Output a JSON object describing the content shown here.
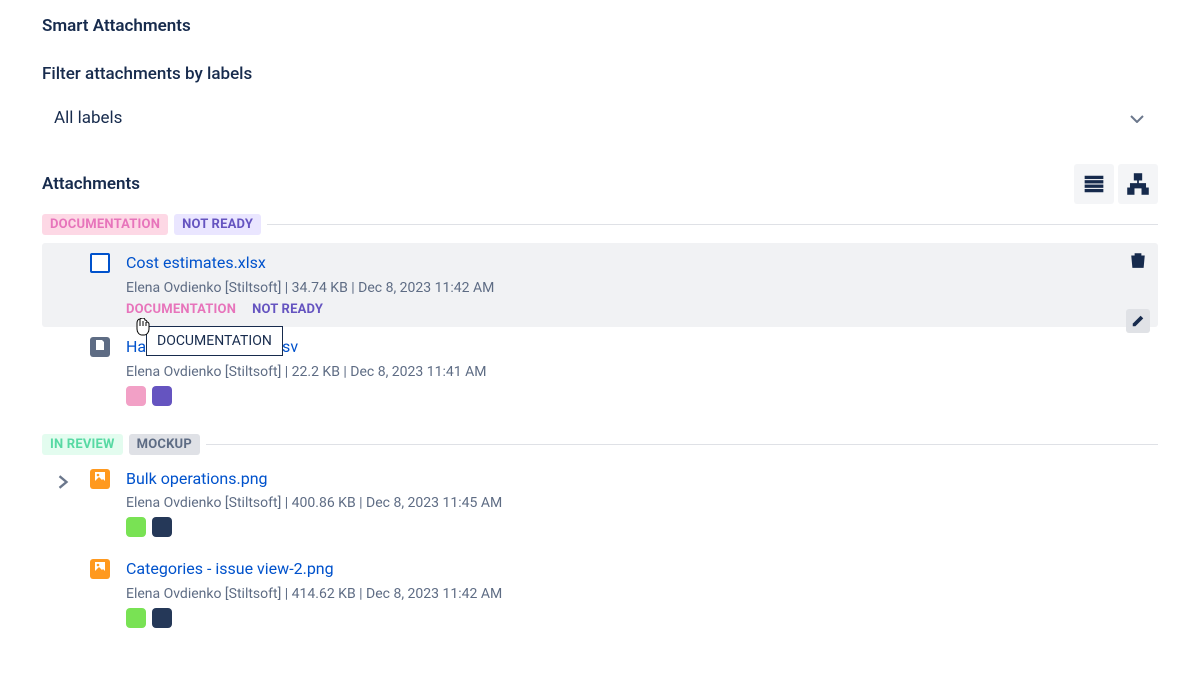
{
  "pageTitle": "Smart Attachments",
  "filterLabel": "Filter attachments by labels",
  "filterDropdown": {
    "selected": "All labels"
  },
  "sectionTitle": "Attachments",
  "tooltipText": "DOCUMENTATION",
  "groups": [
    {
      "tags": [
        {
          "label": "DOCUMENTATION",
          "style": "doc"
        },
        {
          "label": "NOT READY",
          "style": "notready"
        }
      ],
      "items": [
        {
          "id": "cost-estimates",
          "iconType": "blank-square",
          "name": "Cost estimates.xlsx",
          "meta": "Elena Ovdienko [Stiltsoft] | 34.74 KB | Dec 8, 2023 11:42 AM",
          "textLabels": [
            {
              "text": "DOCUMENTATION",
              "style": "doc"
            },
            {
              "text": "NOT READY",
              "style": "notready"
            }
          ],
          "hovered": true,
          "hasActions": true
        },
        {
          "id": "hardware-estimates",
          "iconType": "doc-gray",
          "name": "Hardware estimates.csv",
          "partialLeft": "Ha",
          "partialRight": "tes.csv",
          "meta": "Elena Ovdienko [Stiltsoft] | 22.2 KB | Dec 8, 2023 11:41 AM",
          "chips": [
            "pink",
            "purple"
          ]
        }
      ]
    },
    {
      "tags": [
        {
          "label": "IN REVIEW",
          "style": "inreview"
        },
        {
          "label": "MOCKUP",
          "style": "mockup"
        }
      ],
      "hasExpander": true,
      "items": [
        {
          "id": "bulk-operations",
          "iconType": "image-orange",
          "name": "Bulk operations.png",
          "meta": "Elena Ovdienko [Stiltsoft] | 400.86 KB | Dec 8, 2023 11:45 AM",
          "chips": [
            "green",
            "navy"
          ]
        },
        {
          "id": "categories-issue-view",
          "iconType": "image-orange",
          "name": "Categories - issue view-2.png",
          "meta": "Elena Ovdienko [Stiltsoft] | 414.62 KB | Dec 8, 2023 11:42 AM",
          "chips": [
            "green",
            "navy"
          ]
        }
      ]
    }
  ]
}
